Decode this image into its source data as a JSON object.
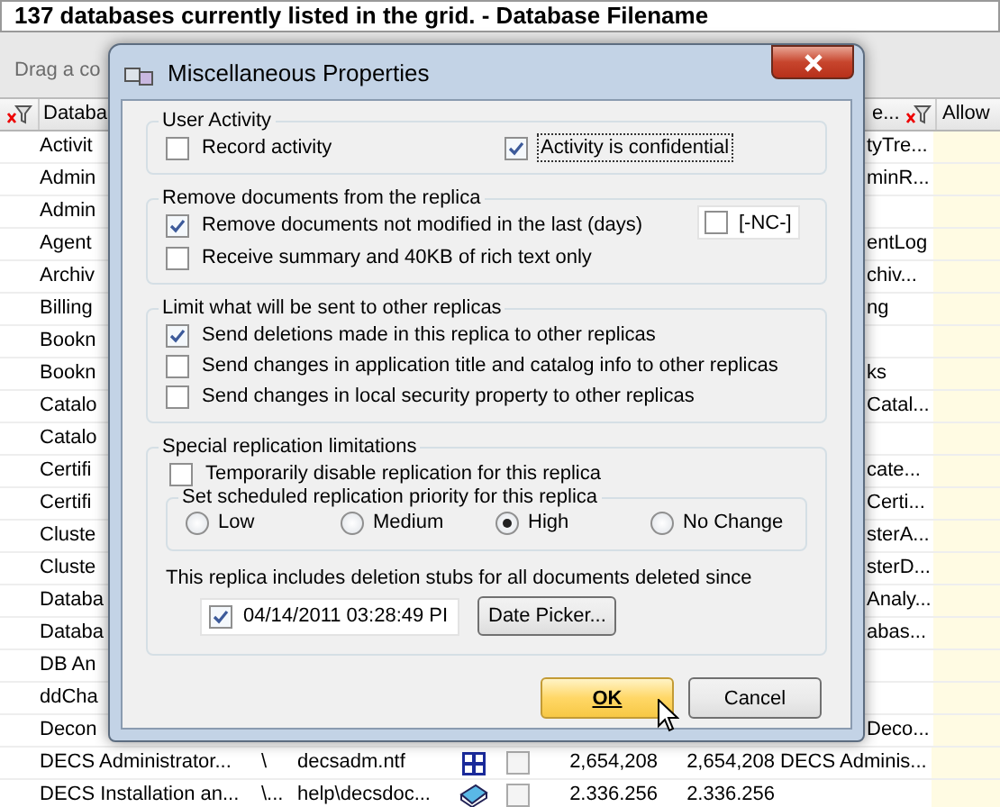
{
  "window": {
    "title": "137 databases currently listed in the grid. - Database Filename"
  },
  "group_panel": {
    "hint": "Drag a co"
  },
  "grid": {
    "headers": [
      "Databa",
      "e...",
      "Allow"
    ],
    "rows": [
      {
        "name": "Activit",
        "title": "tyTre..."
      },
      {
        "name": "Admin",
        "title": "minR..."
      },
      {
        "name": "Admin"
      },
      {
        "name": "Agent",
        "title": "entLog"
      },
      {
        "name": "Archiv",
        "title": "chiv..."
      },
      {
        "name": "Billing",
        "title": "ng"
      },
      {
        "name": "Bookn"
      },
      {
        "name": "Bookn",
        "title": "ks"
      },
      {
        "name": "Catalo",
        "title": "Catal..."
      },
      {
        "name": "Catalo"
      },
      {
        "name": "Certifi",
        "title": "cate..."
      },
      {
        "name": "Certifi",
        "title": "Certi..."
      },
      {
        "name": "Cluste",
        "title": "sterA..."
      },
      {
        "name": "Cluste",
        "title": "sterD..."
      },
      {
        "name": "Databa",
        "title": "Analy..."
      },
      {
        "name": "Databa",
        "title": "abas..."
      },
      {
        "name": "DB An"
      },
      {
        "name": "ddCha"
      },
      {
        "name": "Decon",
        "title": "Deco..."
      },
      {
        "name": "DECS Administrator...",
        "folder": "\\",
        "file": "decsadm.ntf",
        "checked": false,
        "size": "2,654,208",
        "size2": "2,654,208",
        "title": "DECS Adminis..."
      },
      {
        "name": "DECS Installation an...",
        "folder": "\\...",
        "file": "help\\decsdoc...",
        "checked": false,
        "size": "2.336.256",
        "size2": "2.336.256"
      }
    ]
  },
  "dialog": {
    "title": "Miscellaneous Properties",
    "user_activity": {
      "title": "User Activity",
      "options": [
        {
          "label": "Record activity",
          "checked": false,
          "focused": false
        },
        {
          "label": "Activity is confidential",
          "checked": true,
          "focused": true
        }
      ]
    },
    "remove_documents": {
      "title": "Remove documents from the replica",
      "options": [
        {
          "label": "Remove documents not modified in the last (days)",
          "checked": true
        },
        {
          "label": "Receive summary and 40KB of rich text only",
          "checked": false
        }
      ],
      "days_field": {
        "checked": false,
        "value": "[-NC-]"
      }
    },
    "limit_sent": {
      "title": "Limit what will be sent to other replicas",
      "options": [
        {
          "label": "Send deletions made in this replica to other replicas",
          "checked": true
        },
        {
          "label": "Send changes in application title and catalog info to other replicas",
          "checked": false
        },
        {
          "label": "Send changes in local security property to other replicas",
          "checked": false
        }
      ]
    },
    "special": {
      "title": "Special replication limitations",
      "options": [
        {
          "label": "Temporarily disable replication for this replica",
          "checked": false
        }
      ],
      "priority": {
        "title": "Set scheduled replication priority for this replica",
        "options": [
          {
            "label": "Low",
            "selected": false
          },
          {
            "label": "Medium",
            "selected": false
          },
          {
            "label": "High",
            "selected": true
          },
          {
            "label": "No Change",
            "selected": false
          }
        ]
      },
      "stubs_text": "This replica includes deletion stubs for all documents deleted since",
      "date_field": {
        "checked": true,
        "value": "04/14/2011 03:28:49 PI"
      },
      "date_button": "Date Picker..."
    },
    "buttons": [
      {
        "label": "OK",
        "default": true
      },
      {
        "label": "Cancel",
        "default": false
      }
    ]
  }
}
